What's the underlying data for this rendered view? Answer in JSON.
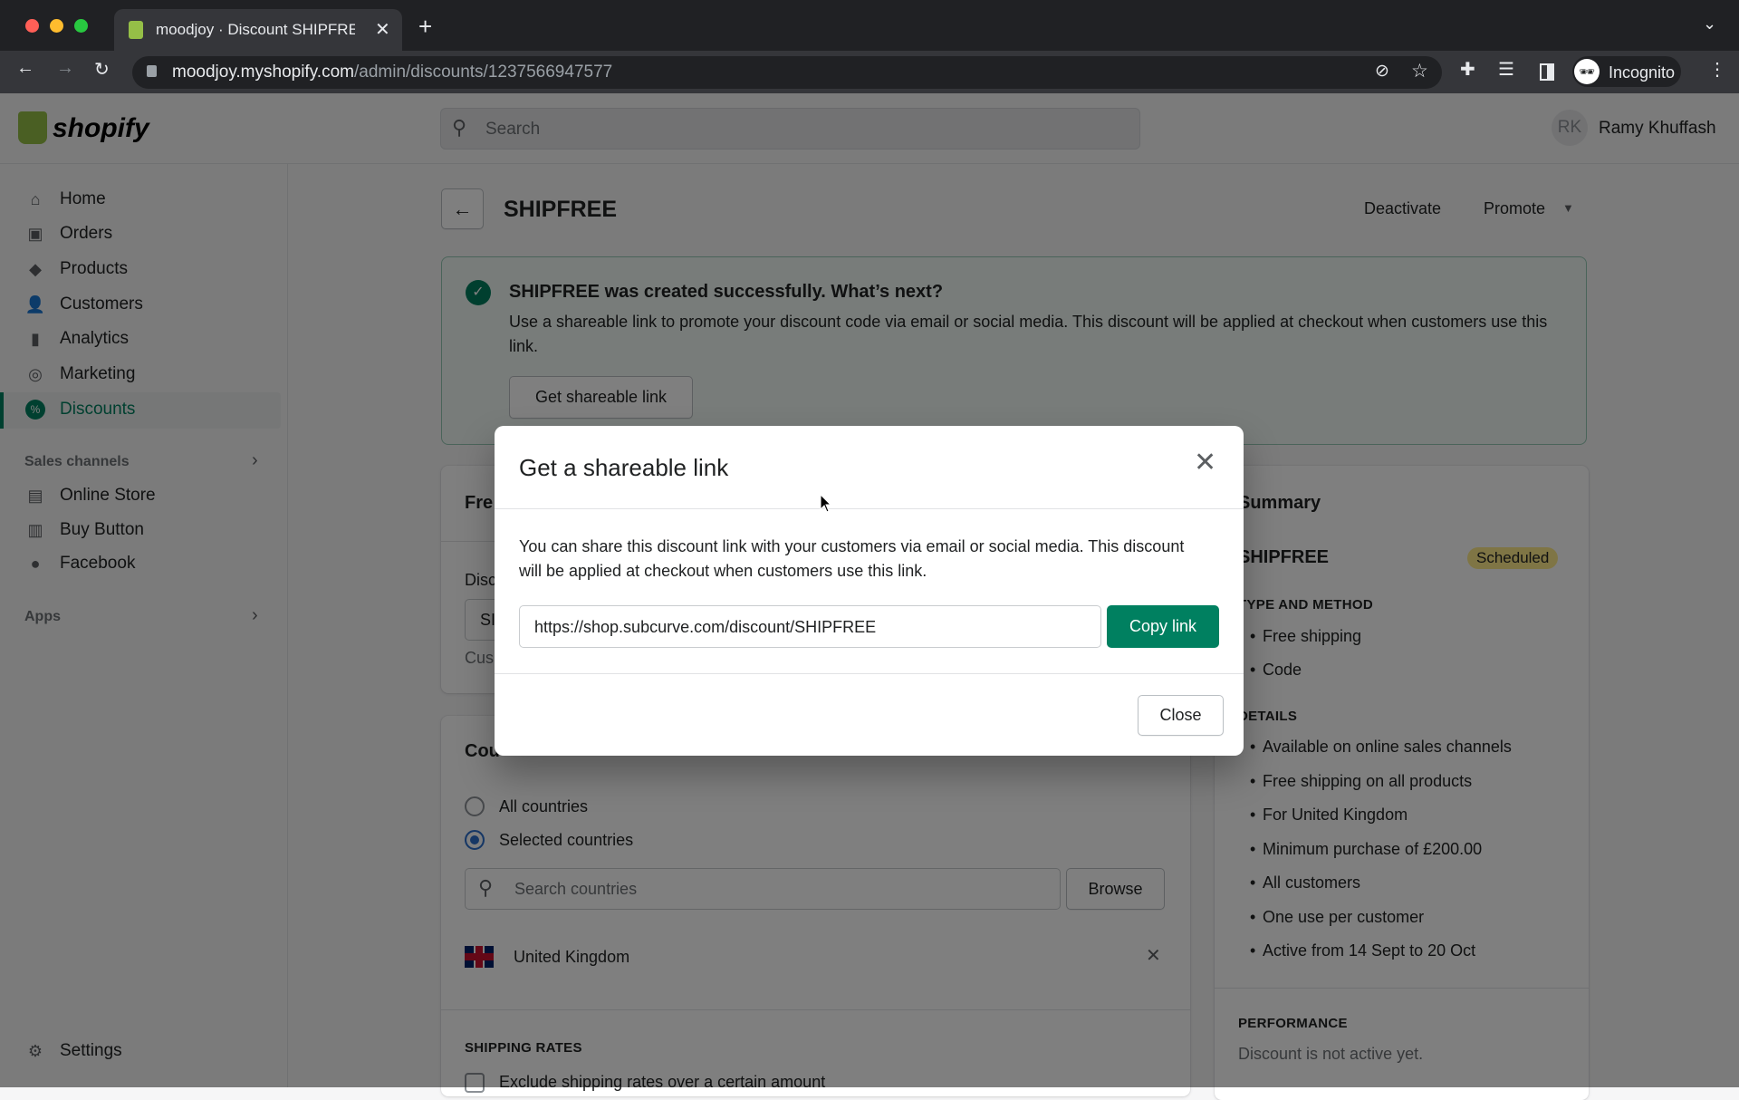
{
  "browser": {
    "tab_title": "moodjoy · Discount SHIPFREE",
    "url_host": "moodjoy.myshopify.com",
    "url_path": "/admin/discounts/1237566947577",
    "profile": "Incognito"
  },
  "topbar": {
    "logo": "shopify",
    "search_placeholder": "Search",
    "user_initials": "RK",
    "user_name": "Ramy Khuffash"
  },
  "sidebar": {
    "items": [
      {
        "label": "Home",
        "icon": "home-icon"
      },
      {
        "label": "Orders",
        "icon": "orders-icon"
      },
      {
        "label": "Products",
        "icon": "tag-icon"
      },
      {
        "label": "Customers",
        "icon": "person-icon"
      },
      {
        "label": "Analytics",
        "icon": "bar-chart-icon"
      },
      {
        "label": "Marketing",
        "icon": "target-icon"
      },
      {
        "label": "Discounts",
        "icon": "discount-icon",
        "active": true
      }
    ],
    "sales_channels_label": "Sales channels",
    "channels": [
      {
        "label": "Online Store"
      },
      {
        "label": "Buy Button"
      },
      {
        "label": "Facebook"
      }
    ],
    "apps_label": "Apps",
    "settings_label": "Settings"
  },
  "page": {
    "title": "SHIPFREE",
    "deactivate": "Deactivate",
    "promote": "Promote",
    "banner": {
      "title": "SHIPFREE was created successfully. What’s next?",
      "text": "Use a shareable link to promote your discount code via email or social media. This discount will be applied at checkout when customers use this link.",
      "button": "Get shareable link"
    },
    "card1": {
      "title_partial": "Fre",
      "label_partial": "Disc",
      "input_partial": "SI",
      "help_partial": "Cus"
    },
    "countries": {
      "title_partial": "Cou",
      "all": "All countries",
      "selected": "Selected countries",
      "search_placeholder": "Search countries",
      "browse": "Browse",
      "country": "United Kingdom"
    },
    "shipping": {
      "title": "SHIPPING RATES",
      "checkbox": "Exclude shipping rates over a certain amount"
    },
    "summary": {
      "title": "Summary",
      "code": "SHIPFREE",
      "status": "Scheduled",
      "type_title": "TYPE AND METHOD",
      "type_items": [
        "Free shipping",
        "Code"
      ],
      "details_title": "DETAILS",
      "details_items": [
        "Available on online sales channels",
        "Free shipping on all products",
        "For United Kingdom",
        "Minimum purchase of £200.00",
        "All customers",
        "One use per customer",
        "Active from 14 Sept to 20 Oct"
      ],
      "performance_title": "PERFORMANCE",
      "performance_text": "Discount is not active yet."
    }
  },
  "modal": {
    "title": "Get a shareable link",
    "text": "You can share this discount link with your customers via email or social media. This discount will be applied at checkout when customers use this link.",
    "link": "https://shop.subcurve.com/discount/SHIPFREE",
    "copy": "Copy link",
    "close": "Close"
  },
  "colors": {
    "accent": "#008060",
    "badge": "#ffea8a"
  }
}
